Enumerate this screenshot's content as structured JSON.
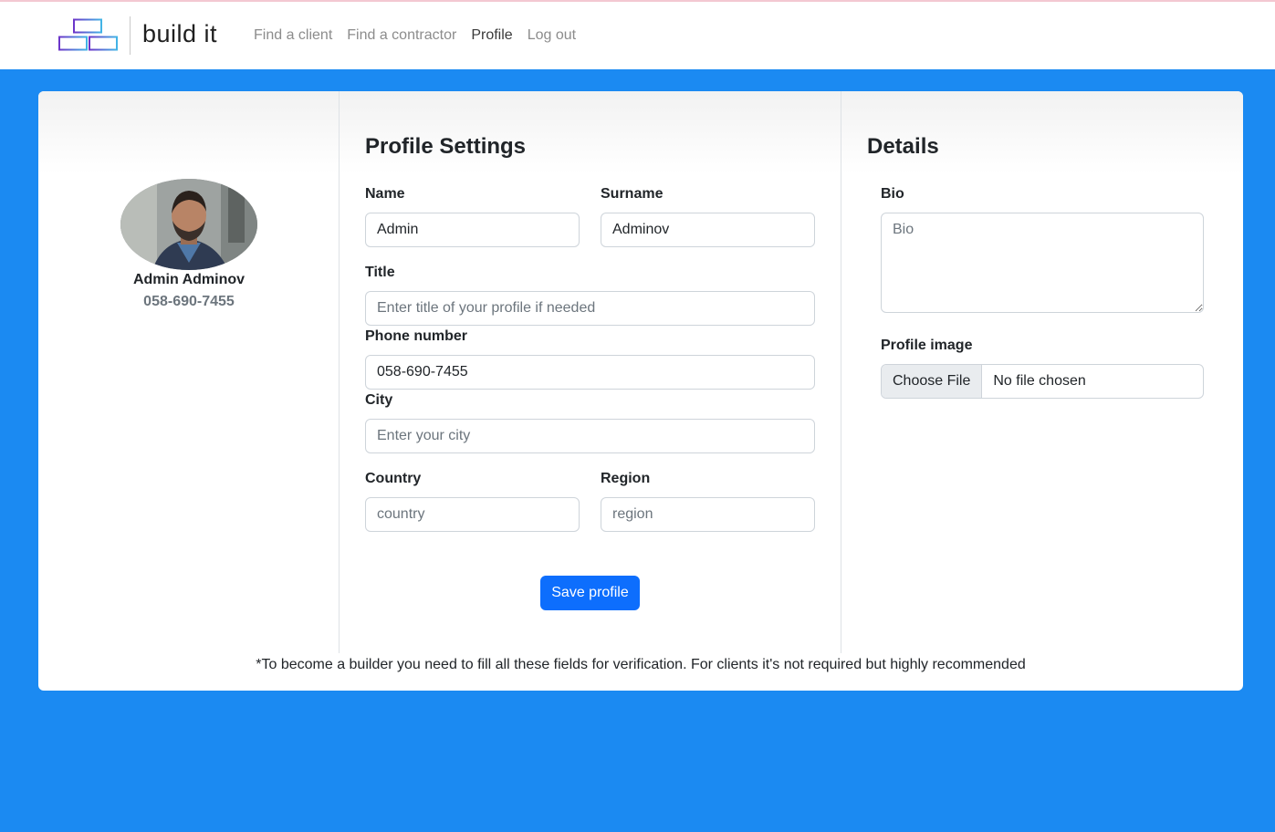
{
  "colors": {
    "page_background": "#1b8af2",
    "primary_button": "#0d6efd",
    "logo_purple": "#6c35c9",
    "logo_blue": "#42b4e6"
  },
  "navbar": {
    "brand": "build it",
    "links": [
      {
        "label": "Find a client",
        "active": false
      },
      {
        "label": "Find a contractor",
        "active": false
      },
      {
        "label": "Profile",
        "active": true
      },
      {
        "label": "Log out",
        "active": false
      }
    ]
  },
  "profile_card": {
    "name": "Admin Adminov",
    "phone": "058-690-7455"
  },
  "settings": {
    "title": "Profile Settings",
    "name_label": "Name",
    "name_value": "Admin",
    "surname_label": "Surname",
    "surname_value": "Adminov",
    "title_label": "Title",
    "title_placeholder": "Enter title of your profile if needed",
    "phone_label": "Phone number",
    "phone_value": "058-690-7455",
    "city_label": "City",
    "city_placeholder": "Enter your city",
    "country_label": "Country",
    "country_placeholder": "country",
    "region_label": "Region",
    "region_placeholder": "region",
    "save_label": "Save profile"
  },
  "details": {
    "title": "Details",
    "bio_label": "Bio",
    "bio_placeholder": "Bio",
    "image_label": "Profile image",
    "choose_file_label": "Choose File",
    "no_file_label": "No file chosen"
  },
  "footnote": "*To become a builder you need to fill all these fields for verification. For clients it's not required but highly recommended"
}
